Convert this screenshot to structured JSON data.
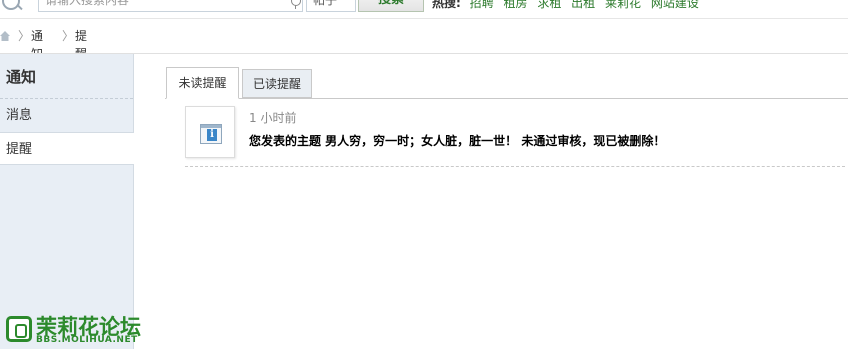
{
  "topbar": {
    "search_placeholder": "请输入搜索内容",
    "search_type": "帖子",
    "search_button": "搜索",
    "hot_label": "热搜:",
    "hot_links": [
      "招聘",
      "租房",
      "求租",
      "出租",
      "莱莉花",
      "网站建设"
    ]
  },
  "breadcrumb": {
    "items": [
      "通知",
      "提醒"
    ]
  },
  "sidebar": {
    "title": "通知",
    "items": [
      {
        "label": "消息"
      },
      {
        "label": "提醒"
      }
    ]
  },
  "tabs": {
    "unread": "未读提醒",
    "read": "已读提醒"
  },
  "notice": {
    "time": "1 小时前",
    "text": "您发表的主题 男人穷，穷一时；女人脏，脏一世！ 未通过审核，现已被删除！"
  },
  "logo": {
    "name": "茉莉花论坛",
    "url": "BBS.MOLIHUA.NET"
  },
  "colors": {
    "brand_green": "#2c8a2c",
    "sidebar_bg": "#e8eef5"
  }
}
